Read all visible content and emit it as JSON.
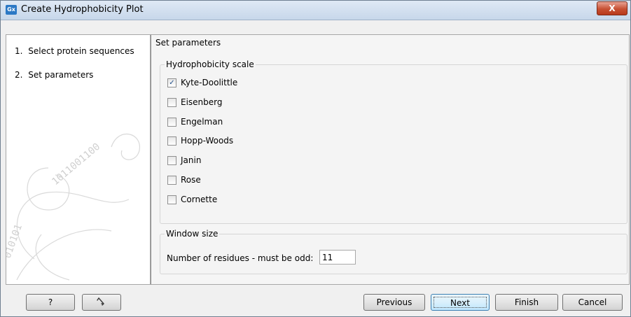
{
  "window": {
    "title": "Create Hydrophobicity Plot",
    "app_icon_text": "Gx",
    "close_glyph": "X"
  },
  "steps": [
    {
      "number": "1.",
      "label": "Select protein sequences"
    },
    {
      "number": "2.",
      "label": "Set parameters"
    }
  ],
  "main": {
    "title": "Set parameters",
    "hydro_group": {
      "legend": "Hydrophobicity scale",
      "options": [
        {
          "label": "Kyte-Doolittle",
          "checked": true
        },
        {
          "label": "Eisenberg",
          "checked": false
        },
        {
          "label": "Engelman",
          "checked": false
        },
        {
          "label": "Hopp-Woods",
          "checked": false
        },
        {
          "label": "Janin",
          "checked": false
        },
        {
          "label": "Rose",
          "checked": false
        },
        {
          "label": "Cornette",
          "checked": false
        }
      ]
    },
    "window_group": {
      "legend": "Window size",
      "field_label": "Number of residues - must be odd:",
      "field_value": "11"
    }
  },
  "footer": {
    "help_label": "?",
    "reset_icon": "undo-arrow-icon",
    "previous_label": "Previous",
    "next_label": "Next",
    "finish_label": "Finish",
    "cancel_label": "Cancel"
  },
  "colors": {
    "titlebar": "#c7d7ea",
    "close_button": "#c75033",
    "app_icon": "#2b78c5",
    "checkmark": "#214f8a"
  }
}
